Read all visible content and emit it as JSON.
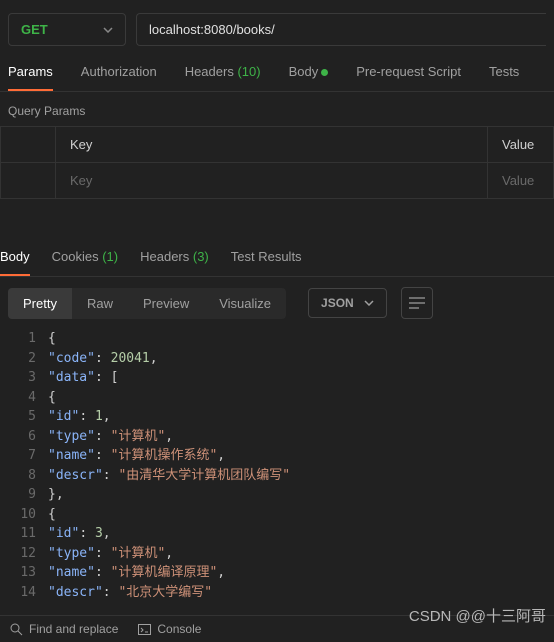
{
  "request": {
    "method": "GET",
    "url": "localhost:8080/books/"
  },
  "tabs": {
    "items": [
      {
        "label": "Params",
        "active": true
      },
      {
        "label": "Authorization",
        "active": false
      },
      {
        "label": "Headers",
        "count": "(10)",
        "active": false
      },
      {
        "label": "Body",
        "dot": true,
        "active": false
      },
      {
        "label": "Pre-request Script",
        "active": false
      },
      {
        "label": "Tests",
        "active": false
      }
    ]
  },
  "paramsSection": {
    "title": "Query Params",
    "headers": {
      "key": "Key",
      "value": "Value"
    },
    "row": {
      "key": "Key",
      "value": "Value"
    }
  },
  "respTabs": {
    "items": [
      {
        "label": "Body",
        "active": true
      },
      {
        "label": "Cookies",
        "count": "(1)",
        "active": false
      },
      {
        "label": "Headers",
        "count": "(3)",
        "active": false
      },
      {
        "label": "Test Results",
        "active": false
      }
    ]
  },
  "viewBtns": {
    "items": [
      {
        "label": "Pretty",
        "active": true
      },
      {
        "label": "Raw",
        "active": false
      },
      {
        "label": "Preview",
        "active": false
      },
      {
        "label": "Visualize",
        "active": false
      }
    ],
    "format": "JSON"
  },
  "code": {
    "lines": [
      {
        "n": "1",
        "t": [
          {
            "c": "pun",
            "v": "{"
          }
        ]
      },
      {
        "n": "2",
        "t": [
          {
            "c": "ind",
            "v": "    "
          },
          {
            "c": "key",
            "v": "\"code\""
          },
          {
            "c": "pun",
            "v": ": "
          },
          {
            "c": "num",
            "v": "20041"
          },
          {
            "c": "pun",
            "v": ","
          }
        ]
      },
      {
        "n": "3",
        "t": [
          {
            "c": "ind",
            "v": "    "
          },
          {
            "c": "key",
            "v": "\"data\""
          },
          {
            "c": "pun",
            "v": ": ["
          }
        ]
      },
      {
        "n": "4",
        "t": [
          {
            "c": "ind",
            "v": "        "
          },
          {
            "c": "pun",
            "v": "{"
          }
        ]
      },
      {
        "n": "5",
        "t": [
          {
            "c": "ind",
            "v": "            "
          },
          {
            "c": "key",
            "v": "\"id\""
          },
          {
            "c": "pun",
            "v": ": "
          },
          {
            "c": "num",
            "v": "1"
          },
          {
            "c": "pun",
            "v": ","
          }
        ]
      },
      {
        "n": "6",
        "t": [
          {
            "c": "ind",
            "v": "            "
          },
          {
            "c": "key",
            "v": "\"type\""
          },
          {
            "c": "pun",
            "v": ": "
          },
          {
            "c": "str",
            "v": "\"计算机\""
          },
          {
            "c": "pun",
            "v": ","
          }
        ]
      },
      {
        "n": "7",
        "t": [
          {
            "c": "ind",
            "v": "            "
          },
          {
            "c": "key",
            "v": "\"name\""
          },
          {
            "c": "pun",
            "v": ": "
          },
          {
            "c": "str",
            "v": "\"计算机操作系统\""
          },
          {
            "c": "pun",
            "v": ","
          }
        ]
      },
      {
        "n": "8",
        "t": [
          {
            "c": "ind",
            "v": "            "
          },
          {
            "c": "key",
            "v": "\"descr\""
          },
          {
            "c": "pun",
            "v": ": "
          },
          {
            "c": "str",
            "v": "\"由清华大学计算机团队编写\""
          }
        ]
      },
      {
        "n": "9",
        "t": [
          {
            "c": "ind",
            "v": "        "
          },
          {
            "c": "pun",
            "v": "},"
          }
        ]
      },
      {
        "n": "10",
        "t": [
          {
            "c": "ind",
            "v": "        "
          },
          {
            "c": "pun",
            "v": "{"
          }
        ]
      },
      {
        "n": "11",
        "t": [
          {
            "c": "ind",
            "v": "            "
          },
          {
            "c": "key",
            "v": "\"id\""
          },
          {
            "c": "pun",
            "v": ": "
          },
          {
            "c": "num",
            "v": "3"
          },
          {
            "c": "pun",
            "v": ","
          }
        ]
      },
      {
        "n": "12",
        "t": [
          {
            "c": "ind",
            "v": "            "
          },
          {
            "c": "key",
            "v": "\"type\""
          },
          {
            "c": "pun",
            "v": ": "
          },
          {
            "c": "str",
            "v": "\"计算机\""
          },
          {
            "c": "pun",
            "v": ","
          }
        ]
      },
      {
        "n": "13",
        "t": [
          {
            "c": "ind",
            "v": "            "
          },
          {
            "c": "key",
            "v": "\"name\""
          },
          {
            "c": "pun",
            "v": ": "
          },
          {
            "c": "str",
            "v": "\"计算机编译原理\""
          },
          {
            "c": "pun",
            "v": ","
          }
        ]
      },
      {
        "n": "14",
        "t": [
          {
            "c": "ind",
            "v": "            "
          },
          {
            "c": "key",
            "v": "\"descr\""
          },
          {
            "c": "pun",
            "v": ": "
          },
          {
            "c": "str",
            "v": "\"北京大学编写\""
          }
        ]
      }
    ]
  },
  "footer": {
    "find": "Find and replace",
    "console": "Console"
  },
  "watermark": "CSDN @@十三阿哥"
}
